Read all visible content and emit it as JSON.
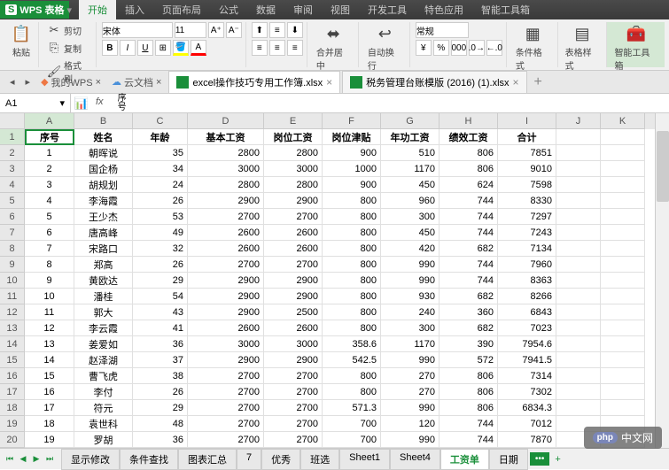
{
  "app": {
    "name": "WPS 表格",
    "logo": "S"
  },
  "menu": [
    "开始",
    "插入",
    "页面布局",
    "公式",
    "数据",
    "审阅",
    "视图",
    "开发工具",
    "特色应用",
    "智能工具箱"
  ],
  "active_menu": 0,
  "ribbon": {
    "paste": "粘贴",
    "cut": "剪切",
    "copy": "复制",
    "format_painter": "格式刷",
    "font": "宋体",
    "size": "11",
    "merge": "合并居中",
    "wrap": "自动换行",
    "number_format": "常规",
    "cond_format": "条件格式",
    "table_style": "表格样式",
    "smart_tools": "智能工具箱"
  },
  "doc_tabs": {
    "home": "我的WPS",
    "cloud": "云文档",
    "files": [
      "excel操作技巧专用工作簿.xlsx",
      "税务管理台账模版 (2016) (1).xlsx"
    ],
    "active": 0
  },
  "cell_ref": "A1",
  "formula_value": "序号",
  "columns": [
    "A",
    "B",
    "C",
    "D",
    "E",
    "F",
    "G",
    "H",
    "I",
    "J",
    "K"
  ],
  "headers": [
    "序号",
    "姓名",
    "年龄",
    "基本工资",
    "岗位工资",
    "岗位津贴",
    "年功工资",
    "绩效工资",
    "合计"
  ],
  "rows": [
    [
      1,
      "朝晖说",
      35,
      2800,
      2800,
      900,
      510,
      806,
      7851
    ],
    [
      2,
      "国企杨",
      34,
      3000,
      3000,
      1000,
      1170,
      806,
      9010
    ],
    [
      3,
      "胡规划",
      24,
      2800,
      2800,
      900,
      450,
      624,
      7598
    ],
    [
      4,
      "李海霞",
      26,
      2900,
      2900,
      800,
      960,
      744,
      8330
    ],
    [
      5,
      "王少杰",
      53,
      2700,
      2700,
      800,
      300,
      744,
      7297
    ],
    [
      6,
      "唐高峰",
      49,
      2600,
      2600,
      800,
      450,
      744,
      7243
    ],
    [
      7,
      "宋路口",
      32,
      2600,
      2600,
      800,
      420,
      682,
      7134
    ],
    [
      8,
      "郑高",
      26,
      2700,
      2700,
      800,
      990,
      744,
      7960
    ],
    [
      9,
      "黄欧达",
      29,
      2900,
      2900,
      800,
      990,
      744,
      8363
    ],
    [
      10,
      "潘桂",
      54,
      2900,
      2900,
      800,
      930,
      682,
      8266
    ],
    [
      11,
      "郭大",
      43,
      2900,
      2500,
      800,
      240,
      360,
      6843
    ],
    [
      12,
      "李云霞",
      41,
      2600,
      2600,
      800,
      300,
      682,
      7023
    ],
    [
      13,
      "姜爱如",
      36,
      3000,
      3000,
      358.6,
      1170,
      390,
      "7954.6"
    ],
    [
      14,
      "赵泽湖",
      37,
      2900,
      2900,
      "542.5",
      990,
      572,
      "7941.5"
    ],
    [
      15,
      "曹飞虎",
      38,
      2700,
      2700,
      800,
      270,
      806,
      7314
    ],
    [
      16,
      "李付",
      26,
      2700,
      2700,
      800,
      270,
      806,
      7302
    ],
    [
      17,
      "符元",
      29,
      2700,
      2700,
      "571.3",
      990,
      806,
      "6834.3"
    ],
    [
      18,
      "袁世科",
      48,
      2700,
      2700,
      700,
      120,
      744,
      7012
    ],
    [
      19,
      "罗胡",
      36,
      2700,
      2700,
      700,
      990,
      744,
      7870
    ]
  ],
  "sheet_tabs": [
    "显示修改",
    "条件查找",
    "图表汇总",
    "7",
    "优秀",
    "班选",
    "Sheet1",
    "Sheet4",
    "工资单",
    "日期"
  ],
  "active_sheet": 8,
  "watermark": "中文网"
}
